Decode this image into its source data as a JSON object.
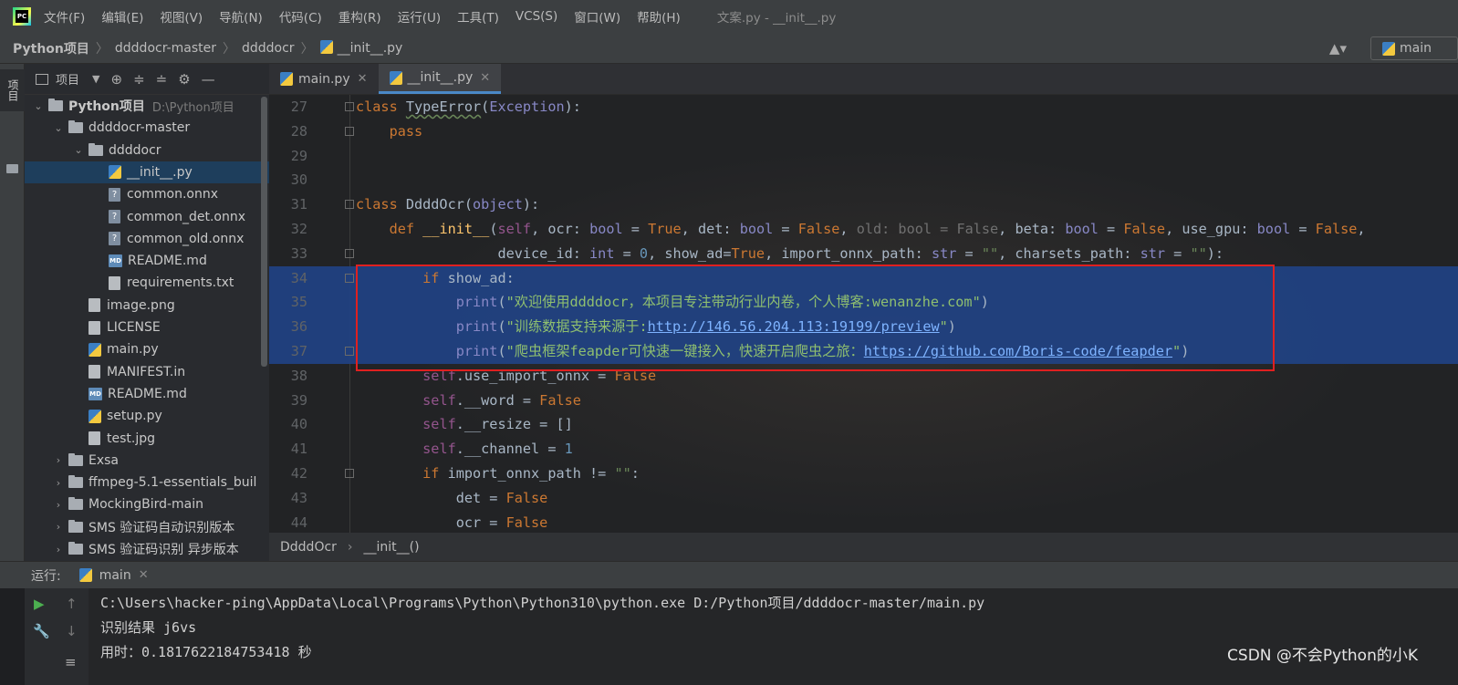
{
  "menubar": {
    "logo_text": "PC",
    "items": [
      "文件(F)",
      "编辑(E)",
      "视图(V)",
      "导航(N)",
      "代码(C)",
      "重构(R)",
      "运行(U)",
      "工具(T)",
      "VCS(S)",
      "窗口(W)",
      "帮助(H)"
    ],
    "window_title": "文案.py - __init__.py"
  },
  "navbar": {
    "crumbs": [
      "Python项目",
      "ddddocr-master",
      "ddddocr",
      "__init__.py"
    ],
    "user_icon": "▲▾",
    "run_config": "main"
  },
  "left_strip": {
    "project_tab": "项目"
  },
  "project_panel": {
    "title": "项目",
    "toolbar_icons": [
      "⊕",
      "≑",
      "≐",
      "⚙",
      "—"
    ],
    "tree": [
      {
        "indent": 0,
        "arrow": "⌄",
        "icon": "folder",
        "label": "Python项目",
        "hint": "D:\\Python项目",
        "bold": true
      },
      {
        "indent": 1,
        "arrow": "⌄",
        "icon": "folder",
        "label": "ddddocr-master"
      },
      {
        "indent": 2,
        "arrow": "⌄",
        "icon": "folder",
        "label": "ddddocr"
      },
      {
        "indent": 3,
        "arrow": "",
        "icon": "py",
        "label": "__init__.py",
        "selected": true
      },
      {
        "indent": 3,
        "arrow": "",
        "icon": "unk",
        "label": "common.onnx"
      },
      {
        "indent": 3,
        "arrow": "",
        "icon": "unk",
        "label": "common_det.onnx"
      },
      {
        "indent": 3,
        "arrow": "",
        "icon": "unk",
        "label": "common_old.onnx"
      },
      {
        "indent": 3,
        "arrow": "",
        "icon": "md",
        "label": "README.md"
      },
      {
        "indent": 3,
        "arrow": "",
        "icon": "file",
        "label": "requirements.txt"
      },
      {
        "indent": 2,
        "arrow": "",
        "icon": "file",
        "label": "image.png"
      },
      {
        "indent": 2,
        "arrow": "",
        "icon": "file",
        "label": "LICENSE"
      },
      {
        "indent": 2,
        "arrow": "",
        "icon": "py",
        "label": "main.py"
      },
      {
        "indent": 2,
        "arrow": "",
        "icon": "file",
        "label": "MANIFEST.in"
      },
      {
        "indent": 2,
        "arrow": "",
        "icon": "md",
        "label": "README.md"
      },
      {
        "indent": 2,
        "arrow": "",
        "icon": "py",
        "label": "setup.py"
      },
      {
        "indent": 2,
        "arrow": "",
        "icon": "file",
        "label": "test.jpg"
      },
      {
        "indent": 1,
        "arrow": "›",
        "icon": "folder",
        "label": "Exsa"
      },
      {
        "indent": 1,
        "arrow": "›",
        "icon": "folder",
        "label": "ffmpeg-5.1-essentials_buil"
      },
      {
        "indent": 1,
        "arrow": "›",
        "icon": "folder",
        "label": "MockingBird-main"
      },
      {
        "indent": 1,
        "arrow": "›",
        "icon": "folder",
        "label": "SMS 验证码自动识别版本"
      },
      {
        "indent": 1,
        "arrow": "›",
        "icon": "folder",
        "label": "SMS 验证码识别 异步版本"
      }
    ]
  },
  "editor": {
    "tabs": [
      {
        "label": "main.py",
        "active": false
      },
      {
        "label": "__init__.py",
        "active": true
      }
    ],
    "lines": [
      {
        "n": "27",
        "html": "<span class=\"kw\">class</span> <span class=\"cls\">TypeError</span>(<span class=\"bi\">Exception</span>):"
      },
      {
        "n": "28",
        "html": "    <span class=\"kw\">pass</span>"
      },
      {
        "n": "29",
        "html": ""
      },
      {
        "n": "30",
        "html": ""
      },
      {
        "n": "31",
        "html": "<span class=\"kw\">class</span> DdddOcr(<span class=\"bi\">object</span>):"
      },
      {
        "n": "32",
        "html": "    <span class=\"kw\">def</span> <span class=\"fn\">__init__</span>(<span class=\"self\">self</span>, ocr: <span class=\"bi\">bool</span> = <span class=\"kw\">True</span>, det: <span class=\"bi\">bool</span> = <span class=\"kw\">False</span>, <span class=\"dim\">old: bool = False</span>, beta: <span class=\"bi\">bool</span> = <span class=\"kw\">False</span>, use_gpu: <span class=\"bi\">bool</span> = <span class=\"kw\">False</span>,"
      },
      {
        "n": "33",
        "html": "                 device_id: <span class=\"bi\">int</span> = <span class=\"num\">0</span>, show_ad=<span class=\"kw\">True</span>, import_onnx_path: <span class=\"bi\">str</span> = <span class=\"str\">\"\"</span>, charsets_path: <span class=\"bi\">str</span> = <span class=\"str\">\"\"</span>):"
      },
      {
        "n": "34",
        "html": "        <span class=\"kw\">if</span> show_ad:",
        "hl": true
      },
      {
        "n": "35",
        "html": "            <span class=\"bi\">print</span>(<span class=\"str\">\"欢迎使用ddddocr，本项目专注带动行业内卷，个人博客:wenanzhe.com\"</span>)",
        "hl": true
      },
      {
        "n": "36",
        "html": "            <span class=\"bi\">print</span>(<span class=\"str\">\"训练数据支持来源于:<span class=\"url\">http://146.56.204.113:19199/preview</span>\"</span>)",
        "hl": true
      },
      {
        "n": "37",
        "html": "            <span class=\"bi\">print</span>(<span class=\"str\">\"爬虫框架feapder可快速一键接入，快速开启爬虫之旅：<span class=\"url\">https://github.com/Boris-code/feapder</span>\"</span>)",
        "hl": true
      },
      {
        "n": "38",
        "html": "        <span class=\"self\">self</span>.use_import_onnx = <span class=\"kw\">False</span>"
      },
      {
        "n": "39",
        "html": "        <span class=\"self\">self</span>.__word = <span class=\"kw\">False</span>"
      },
      {
        "n": "40",
        "html": "        <span class=\"self\">self</span>.__resize = []"
      },
      {
        "n": "41",
        "html": "        <span class=\"self\">self</span>.__channel = <span class=\"num\">1</span>"
      },
      {
        "n": "42",
        "html": "        <span class=\"kw\">if</span> import_onnx_path != <span class=\"str\">\"\"</span>:"
      },
      {
        "n": "43",
        "html": "            det = <span class=\"kw\">False</span>"
      },
      {
        "n": "44",
        "html": "            ocr = <span class=\"kw\">False</span>"
      }
    ],
    "breadcrumb": [
      "DdddOcr",
      "__init__()"
    ]
  },
  "run_panel": {
    "label": "运行:",
    "tab": "main",
    "console": [
      "C:\\Users\\hacker-ping\\AppData\\Local\\Programs\\Python\\Python310\\python.exe D:/Python项目/ddddocr-master/main.py",
      "识别结果 j6vs",
      "用时：0.1817622184753418 秒"
    ]
  },
  "watermark": "CSDN @不会Python的小K",
  "colors": {
    "accent": "#4a88c7",
    "selection": "#214283",
    "highlight_box": "#e02020",
    "keyword": "#cc7832",
    "string": "#6a8759",
    "run_green": "#4caf50"
  }
}
